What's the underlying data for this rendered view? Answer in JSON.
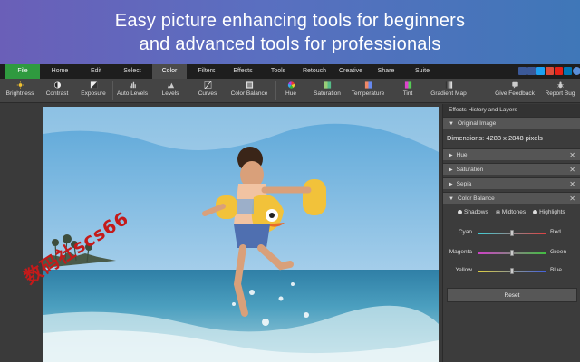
{
  "banner": {
    "line1": "Easy picture enhancing tools for beginners",
    "line2": "and advanced tools for professionals"
  },
  "menu": {
    "items": [
      "File",
      "Home",
      "Edit",
      "Select",
      "Color",
      "Filters",
      "Effects",
      "Tools",
      "Retouch",
      "Creative",
      "Share",
      "Suite"
    ],
    "active": "Color",
    "social_icons": [
      "thumbs-up-icon",
      "facebook-icon",
      "twitter-icon",
      "google-plus-icon",
      "youtube-icon",
      "linkedin-icon",
      "help-icon"
    ],
    "social_colors": [
      "#3b5998",
      "#3b5998",
      "#1da1f2",
      "#dd4b39",
      "#e62117",
      "#0077b5",
      "#5a8fd8"
    ]
  },
  "toolbar": {
    "tools": [
      {
        "label": "Brightness",
        "icon": "sun-icon"
      },
      {
        "label": "Contrast",
        "icon": "contrast-icon"
      },
      {
        "label": "Exposure",
        "icon": "exposure-icon"
      },
      {
        "label": "Auto Levels",
        "icon": "auto-levels-icon"
      },
      {
        "label": "Levels",
        "icon": "levels-icon"
      },
      {
        "label": "Curves",
        "icon": "curves-icon"
      },
      {
        "label": "Color Balance",
        "icon": "color-balance-icon"
      },
      {
        "label": "Hue",
        "icon": "hue-wheel-icon"
      },
      {
        "label": "Saturation",
        "icon": "saturation-icon"
      },
      {
        "label": "Temperature",
        "icon": "temperature-icon"
      },
      {
        "label": "Tint",
        "icon": "tint-icon"
      },
      {
        "label": "Gradient Map",
        "icon": "gradient-map-icon"
      }
    ],
    "feedback": {
      "label": "Give Feedback",
      "icon": "feedback-icon"
    },
    "report": {
      "label": "Report Bug",
      "icon": "bug-icon"
    }
  },
  "watermark": "数码社scs66",
  "panel": {
    "title": "Effects History and Layers",
    "original": {
      "label": "Original Image",
      "dimensions": "Dimensions: 4288 x 2848 pixels"
    },
    "layers": [
      "Hue",
      "Saturation",
      "Sepia"
    ],
    "color_balance": {
      "label": "Color Balance",
      "modes": [
        "Shadows",
        "Midtones",
        "Highlights"
      ],
      "selected_mode": "Midtones",
      "sliders": [
        {
          "left": "Cyan",
          "right": "Red",
          "value": 0.5,
          "colors": [
            "#3fd0d8",
            "#e04040"
          ]
        },
        {
          "left": "Magenta",
          "right": "Green",
          "value": 0.5,
          "colors": [
            "#d040c8",
            "#40c040"
          ]
        },
        {
          "left": "Yellow",
          "right": "Blue",
          "value": 0.5,
          "colors": [
            "#e0d040",
            "#4060e0"
          ]
        }
      ],
      "reset_label": "Reset"
    }
  }
}
